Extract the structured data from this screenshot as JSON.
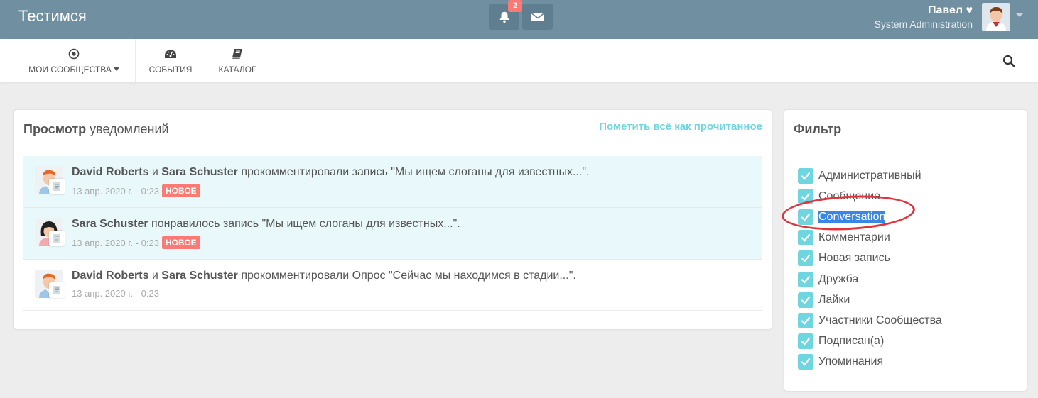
{
  "header": {
    "brand": "Тестимся",
    "notification_count": "2",
    "user_name": "Павел ♥",
    "user_role": "System Administration"
  },
  "nav": {
    "communities": "МОИ СООБЩЕСТВА",
    "events": "СОБЫТИЯ",
    "catalog": "КАТАЛОГ"
  },
  "main": {
    "title_bold": "Просмотр",
    "title_rest": " уведомлений",
    "mark_all": "Пометить всё как прочитанное",
    "notifications": [
      {
        "actor1": "David Roberts",
        "conj": " и ",
        "actor2": "Sara Schuster",
        "text": " прокомментировали запись \"Мы ищем слоганы для известных...\".",
        "time": "13 апр. 2020 г. - 0:23",
        "badge": "НОВОЕ"
      },
      {
        "actor1": "Sara Schuster",
        "text": " понравилось запись \"Мы ищем слоганы для известных...\".",
        "time": "13 апр. 2020 г. - 0:23",
        "badge": "НОВОЕ"
      },
      {
        "actor1": "David Roberts",
        "conj": " и ",
        "actor2": "Sara Schuster",
        "text": " прокомментировали Опрос \"Сейчас мы находимся в стадии...\".",
        "time": "13 апр. 2020 г. - 0:23"
      }
    ]
  },
  "filter": {
    "title": "Фильтр",
    "items": [
      {
        "label": "Административный",
        "checked": true
      },
      {
        "label": "Сообщение",
        "checked": true
      },
      {
        "label": "Conversation",
        "checked": true,
        "selected": true
      },
      {
        "label": "Комментарии",
        "checked": true
      },
      {
        "label": "Новая запись",
        "checked": true
      },
      {
        "label": "Дружба",
        "checked": true
      },
      {
        "label": "Лайки",
        "checked": true
      },
      {
        "label": "Участники Сообщества",
        "checked": true
      },
      {
        "label": "Подписан(а)",
        "checked": true
      },
      {
        "label": "Упоминания",
        "checked": true
      }
    ]
  },
  "colors": {
    "topbar": "#708fa0",
    "accent": "#6fd6df",
    "badge": "#fc7a73",
    "annotation_ring": "#e3333b"
  }
}
